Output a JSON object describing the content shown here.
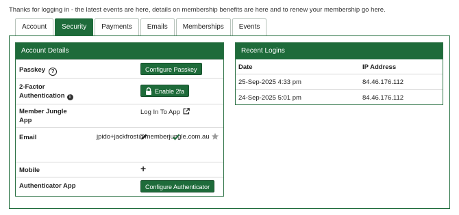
{
  "intro": "Thanks for logging in - the latest events are here, details on membership benefits are here and to renew your membership go here.",
  "tabs": [
    {
      "label": "Account",
      "active": false
    },
    {
      "label": "Security",
      "active": true
    },
    {
      "label": "Payments",
      "active": false
    },
    {
      "label": "Emails",
      "active": false
    },
    {
      "label": "Memberships",
      "active": false
    },
    {
      "label": "Events",
      "active": false
    }
  ],
  "account": {
    "title": "Account Details",
    "passkey_label": "Passkey",
    "passkey_help_icon": "?",
    "passkey_button": "Configure Passkey",
    "twofa_label_1": "2-Factor",
    "twofa_label_2": "Authentication",
    "twofa_info_icon": "i",
    "twofa_button": "Enable 2fa",
    "mj_label_1": "Member Jungle",
    "mj_label_2": "App",
    "mj_link": "Log In To App",
    "email_label": "Email",
    "email_value": "jpido+jackfrost@memberjungle.com.au",
    "mobile_label": "Mobile",
    "mobile_add_icon": "+",
    "auth_label": "Authenticator App",
    "auth_button": "Configure Authenticator"
  },
  "logins": {
    "title": "Recent Logins",
    "col_date": "Date",
    "col_ip": "IP Address",
    "rows": [
      {
        "date": "25-Sep-2025 4:33 pm",
        "ip": "84.46.176.112"
      },
      {
        "date": "24-Sep-2025 5:01 pm",
        "ip": "84.46.176.112"
      }
    ]
  },
  "colors": {
    "accent": "#1e6b3a",
    "border": "#d6d6d6"
  },
  "icons": {
    "edit": "pencil-icon",
    "verified": "check-icon",
    "primary": "star-icon",
    "external": "external-link-icon",
    "lock": "lock-icon"
  }
}
